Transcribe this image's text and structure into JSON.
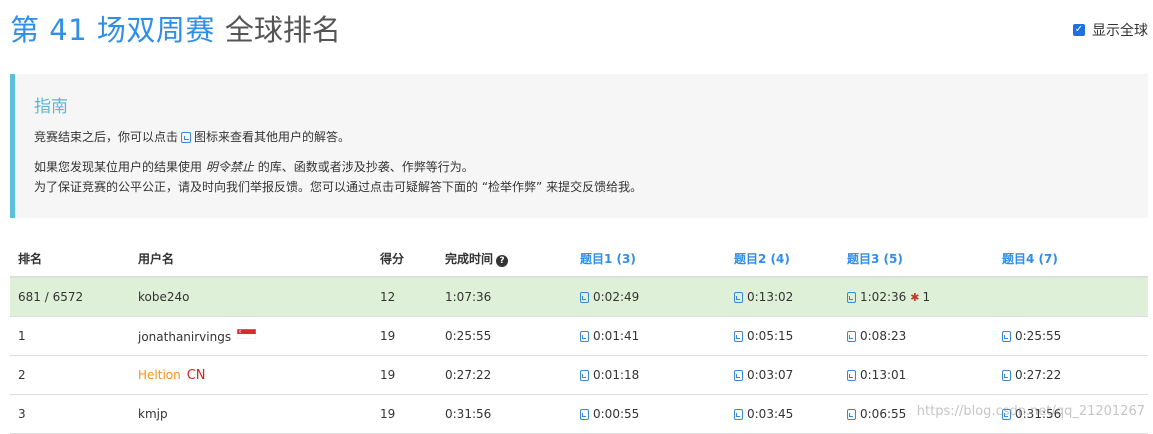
{
  "header": {
    "contest_title": "第 41 场双周赛",
    "rank_title": "全球排名",
    "global_toggle_label": "显示全球",
    "global_toggle_checked": true
  },
  "guide": {
    "heading": "指南",
    "line1_before": "竞赛结束之后，你可以点击",
    "line1_after": "图标来查看其他用户的解答。",
    "line2_before": "如果您发现某位用户的结果使用",
    "line2_emph": "明令禁止",
    "line2_after": "的库、函数或者涉及抄袭、作弊等行为。",
    "line3": "为了保证竞赛的公平公正，请及时向我们举报反馈。您可以通过点击可疑解答下面的 “检举作弊” 来提交反馈给我。"
  },
  "table": {
    "headers": {
      "rank": "排名",
      "username": "用户名",
      "score": "得分",
      "finish_time": "完成时间",
      "q1": "题目1 (3)",
      "q2": "题目2 (4)",
      "q3": "题目3 (5)",
      "q4": "题目4 (7)"
    },
    "my_row": {
      "rank": "681 / 6572",
      "username": "kobe24o",
      "score": "12",
      "finish_time": "1:07:36",
      "q1": "0:02:49",
      "q2": "0:13:02",
      "q3": "1:02:36",
      "q3_wrong": "1",
      "q4": ""
    },
    "rows": [
      {
        "rank": "1",
        "username": "jonathanirvings",
        "flag": "SG",
        "score": "19",
        "finish_time": "0:25:55",
        "q1": "0:01:41",
        "q2": "0:05:15",
        "q3": "0:08:23",
        "q4": "0:25:55"
      },
      {
        "rank": "2",
        "username": "Heltion",
        "region": "CN",
        "score": "19",
        "finish_time": "0:27:22",
        "q1": "0:01:18",
        "q2": "0:03:07",
        "q3": "0:13:01",
        "q4": "0:27:22"
      },
      {
        "rank": "3",
        "username": "kmjp",
        "score": "19",
        "finish_time": "0:31:56",
        "q1": "0:00:55",
        "q2": "0:03:45",
        "q3": "0:06:55",
        "q4": "0:31:56"
      }
    ]
  },
  "watermark": "https://blog.csdn.net/qq_21201267",
  "colors": {
    "accent": "#2e8ee8",
    "my_row_bg": "#dff0d8",
    "guide_border": "#5bc0de",
    "orange_user": "#ff8c1a"
  }
}
